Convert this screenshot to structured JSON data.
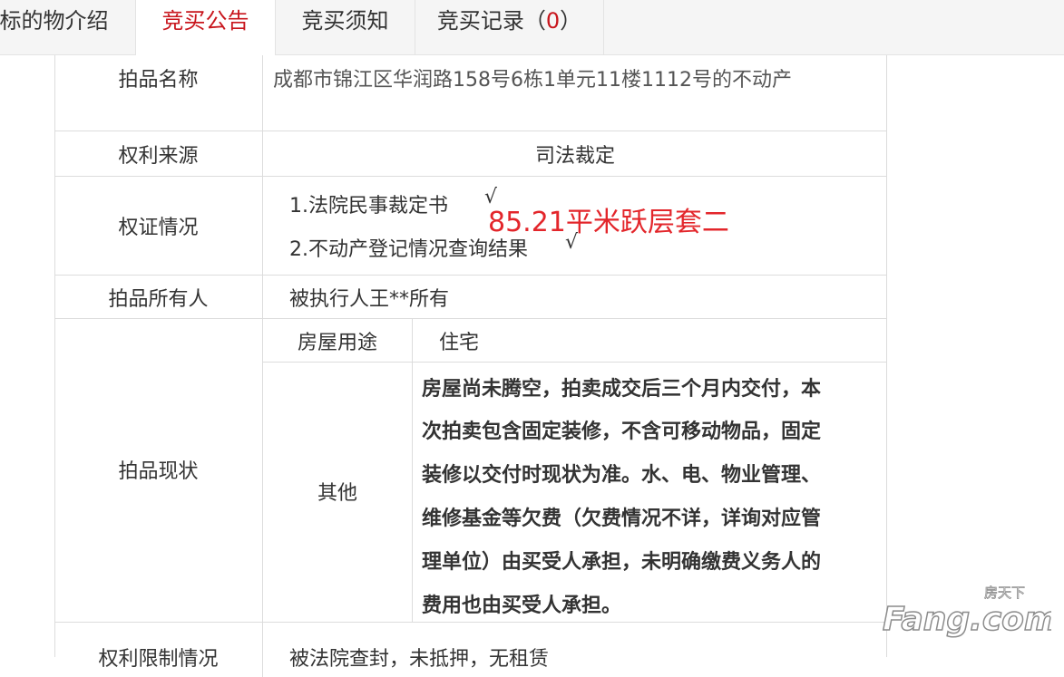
{
  "tabs": [
    {
      "label": "标的物介绍"
    },
    {
      "label": "竞买公告"
    },
    {
      "label": "竞买须知"
    },
    {
      "label": "竞买记录（",
      "count": "0",
      "close": "）"
    }
  ],
  "table": {
    "item_name": {
      "label": "拍品名称",
      "value": "成都市锦江区华润路158号6栋1单元11楼1112号的不动产"
    },
    "rights_source": {
      "label": "权利来源",
      "value": "司法裁定"
    },
    "certificates": {
      "label": "权证情况",
      "items": [
        "1.法院民事裁定书",
        "2.不动产登记情况查询结果"
      ],
      "check": "√"
    },
    "owner": {
      "label": "拍品所有人",
      "value": "被执行人王**所有"
    },
    "status": {
      "label": "拍品现状",
      "usage_label": "房屋用途",
      "usage_value": "住宅",
      "other_label": "其他",
      "other_lines": [
        "房屋尚未腾空，拍卖成交后三个月内交付，本",
        "次拍卖包含固定装修，不含可移动物品，固定",
        "装修以交付时现状为准。水、电、物业管理、",
        "维修基金等欠费（欠费情况不详，详询对应管",
        "理单位）由买受人承担，未明确缴费义务人的",
        "费用也由买受人承担。"
      ]
    },
    "restrictions": {
      "label": "权利限制情况",
      "value": "被法院查封，未抵押，无租赁"
    }
  },
  "annotation": "85.21平米跃层套二",
  "watermark": {
    "cn": "房天下",
    "en": "Fang.com"
  },
  "colors": {
    "accent": "#c8161d",
    "annotation": "#e3262b",
    "border": "#dcdcdc"
  }
}
